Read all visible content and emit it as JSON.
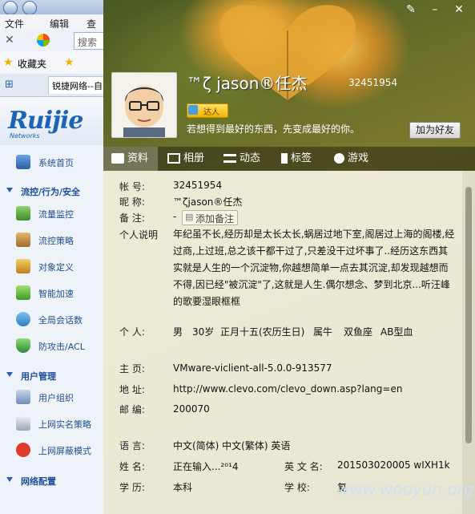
{
  "browser": {
    "menu": [
      "文件",
      "编辑",
      "查"
    ],
    "search_placeholder": "搜索",
    "favorites_label": "收藏夹",
    "tab_title": "锐捷网络--自"
  },
  "sidebar": {
    "logo": "Ruijie",
    "logo_sub": "Networks",
    "items": [
      {
        "label": "系统首页",
        "type": "item"
      },
      {
        "label": "流控/行为/安全",
        "type": "group"
      },
      {
        "label": "流量监控",
        "type": "item"
      },
      {
        "label": "流控策略",
        "type": "item"
      },
      {
        "label": "对象定义",
        "type": "item"
      },
      {
        "label": "智能加速",
        "type": "item"
      },
      {
        "label": "全局会话数",
        "type": "item"
      },
      {
        "label": "防攻击/ACL",
        "type": "item"
      },
      {
        "label": "用户管理",
        "type": "group"
      },
      {
        "label": "用户组织",
        "type": "item"
      },
      {
        "label": "上网实名策略",
        "type": "item"
      },
      {
        "label": "上网屏蔽模式",
        "type": "item"
      },
      {
        "label": "网络配置",
        "type": "group"
      }
    ]
  },
  "profile": {
    "nickname": "™ζ jason®任杰",
    "uid": "32451954",
    "badge": "达人",
    "signature": "若想得到最好的东西，先变成最好的你。",
    "add_friend": "加为好友",
    "tabs": [
      "资料",
      "相册",
      "动态",
      "标签",
      "游戏"
    ],
    "fields": {
      "account_label": "帐    号:",
      "account": "32451954",
      "nick_label": "昵    称:",
      "nick": "™ζjason®任杰",
      "remark_label": "备    注:",
      "remark": "-",
      "remark_btn": "添加备注",
      "bio_label": "个人说明",
      "bio": "年纪虽不长,经历却是太长太长,蜗居过地下室,阁居过上海的阁楼,经过商,上过班,总之该干都干过了,只差没干过坏事了..经历这东西其实就是人生的一个沉淀物,你越想简单一点去其沉淀,却发现越想而不得,因已经\"被沉淀\"了,这就是人生.偶尔想念、梦到北京...听汪峰的歌要湿眼框框",
      "personal_label": "个    人:",
      "gender": "男",
      "age": "30岁",
      "birthday": "正月十五(农历生日)",
      "zodiac": "属牛",
      "star": "双鱼座",
      "blood": "AB型血",
      "homepage_label": "主    页:",
      "homepage": "VMware-viclient-all-5.0.0-913577",
      "address_label": "地    址:",
      "address": "http://www.clevo.com/clevo_down.asp?lang=en",
      "zip_label": "邮    编:",
      "zip": "200070",
      "lang_label": "语    言:",
      "lang": "中文(简体) 中文(繁体) 英语",
      "name_label": "姓    名:",
      "name": "正在输入...²⁰¹4",
      "en_label": "英 文 名:",
      "en_name": "201503020005 wIXH1k",
      "edu_label": "学    历:",
      "edu": "本科",
      "school_label": "学    校:",
      "school": "复"
    }
  },
  "watermark": "www.wooyun.org"
}
